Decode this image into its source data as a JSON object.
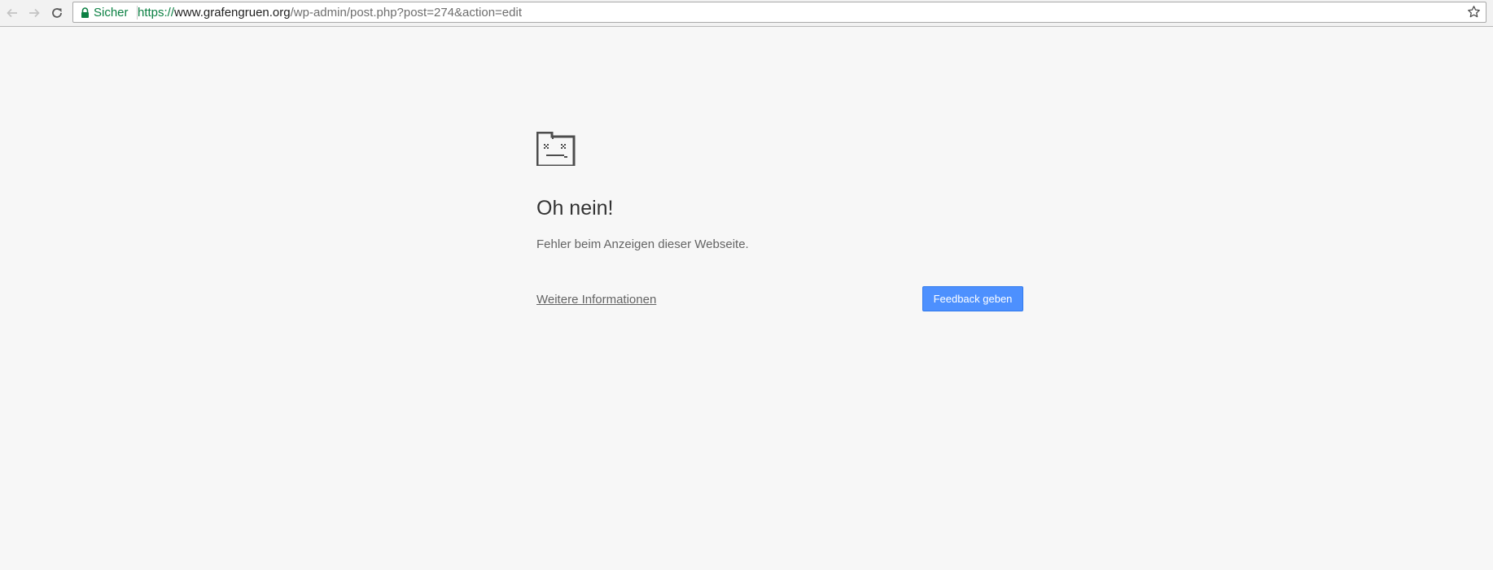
{
  "browser": {
    "back_icon": "arrow-left-icon",
    "forward_icon": "arrow-right-icon",
    "reload_icon": "reload-icon",
    "lock_icon": "lock-icon",
    "bookmark_icon": "star-icon",
    "secure_label": "Sicher",
    "url": {
      "scheme": "https://",
      "host": "www.grafengruen.org",
      "path": "/wp-admin/post.php?post=274&action=edit"
    },
    "colors": {
      "secure": "#0b8043"
    }
  },
  "error_page": {
    "icon": "sad-tab-icon",
    "heading": "Oh nein!",
    "message": "Fehler beim Anzeigen dieser Webseite.",
    "learn_more_label": "Weitere Informationen",
    "feedback_button_label": "Feedback geben",
    "colors": {
      "button": "#4d90fe",
      "background": "#f7f7f7"
    }
  }
}
